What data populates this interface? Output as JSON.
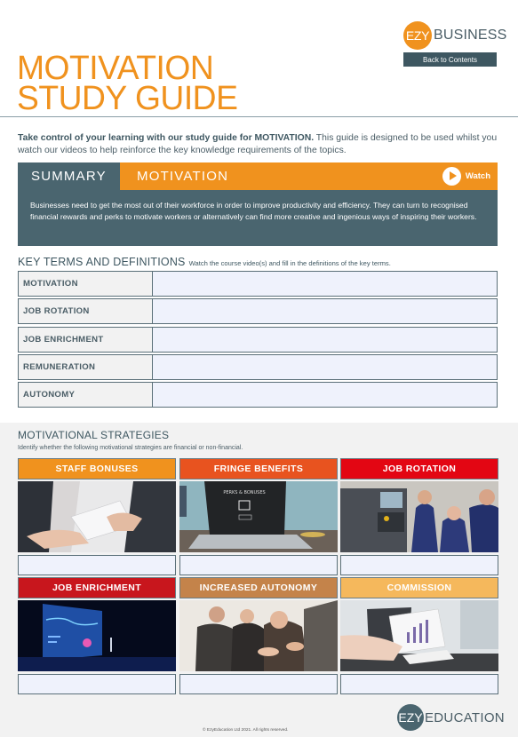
{
  "brand": {
    "top_logo_badge": "EZY",
    "top_logo_word": "BUSINESS",
    "back_button": "Back to Contents",
    "bottom_logo_badge": "EZY",
    "bottom_logo_word": "EDUCATION",
    "colors": {
      "orange": "#f0921e",
      "slate": "#4a656f",
      "dark_slate": "#3e5761",
      "answer_fill": "#eff2fc"
    }
  },
  "title": {
    "line1": "MOTIVATION",
    "line2": "STUDY GUIDE"
  },
  "intro": {
    "bold": "Take control of your learning with our study guide for MOTIVATION.",
    "rest": " This guide is designed to be used whilst you watch our videos to help reinforce the key knowledge requirements of the topics."
  },
  "summary": {
    "tab_label": "SUMMARY",
    "topic": "MOTIVATION",
    "watch_label": "Watch",
    "watch_icon": "play-icon",
    "text": "Businesses need to get the most out of their workforce in order to improve productivity and efficiency. They can turn to recognised financial rewards and perks to motivate workers or alternatively can find more creative and ingenious ways of inspiring their workers."
  },
  "key_terms": {
    "title": "KEY TERMS AND DEFINITIONS",
    "instruction": "Watch the course video(s) and fill in the definitions of the key terms.",
    "rows": [
      {
        "term": "MOTIVATION",
        "definition": ""
      },
      {
        "term": "JOB ROTATION",
        "definition": ""
      },
      {
        "term": "JOB ENRICHMENT",
        "definition": ""
      },
      {
        "term": "REMUNERATION",
        "definition": ""
      },
      {
        "term": "AUTONOMY",
        "definition": ""
      }
    ]
  },
  "strategies": {
    "title": "MOTIVATIONAL STRATEGIES",
    "instruction": "Identify whether the following motivational strategies are financial or non-financial.",
    "cards": [
      {
        "label": "STAFF BONUSES",
        "color": "#f0921e",
        "image": "handing-envelope-photo",
        "answer": ""
      },
      {
        "label": "FRINGE BENEFITS",
        "color": "#e8531f",
        "image": "laptop-perks-bonuses-photo",
        "image_text": "PERKS & BONUSES",
        "answer": ""
      },
      {
        "label": "JOB ROTATION",
        "color": "#e30613",
        "image": "factory-workers-machine-photo",
        "answer": ""
      },
      {
        "label": "JOB ENRICHMENT",
        "color": "#c8161d",
        "image": "presentation-stage-photo",
        "answer": ""
      },
      {
        "label": "INCREASED AUTONOMY",
        "color": "#c4834a",
        "image": "team-applauding-photo",
        "answer": ""
      },
      {
        "label": "COMMISSION",
        "color": "#f5b85c",
        "image": "laptop-charts-calculator-photo",
        "answer": ""
      }
    ]
  },
  "footer": {
    "copyright": "© EzyEducation Ltd 2021. All rights reserved."
  }
}
